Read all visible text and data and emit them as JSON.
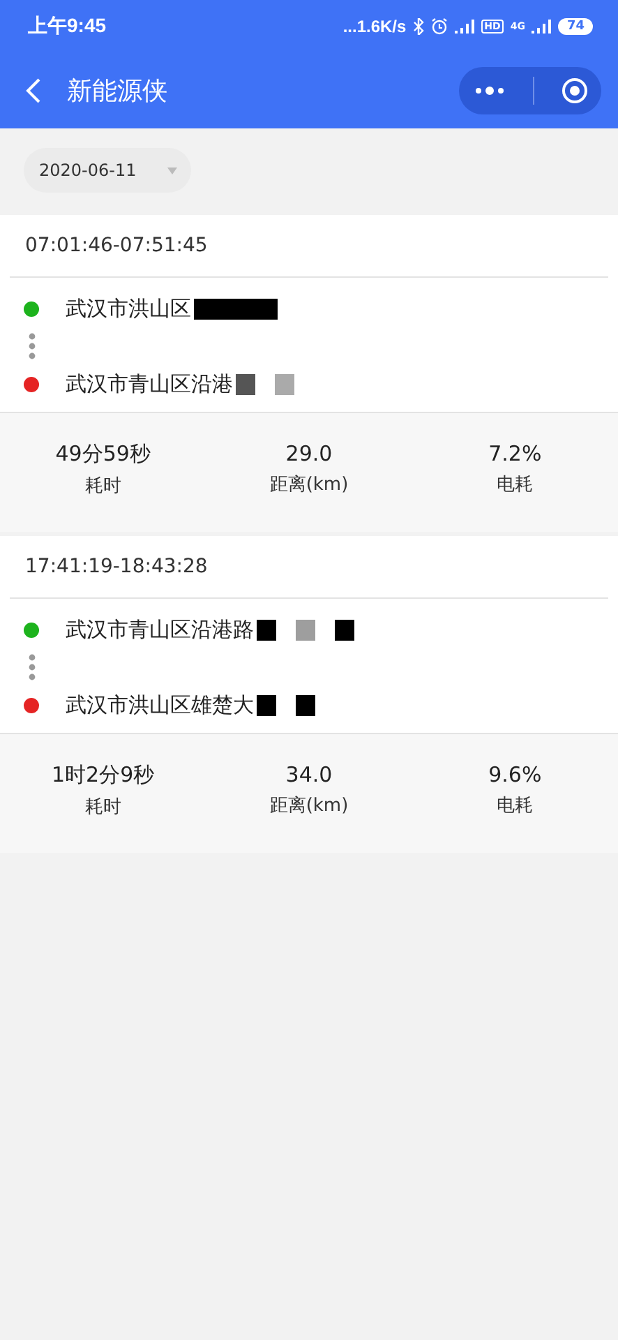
{
  "status_bar": {
    "time": "上午9:45",
    "speed": "...1.6K/s",
    "network": "4G",
    "hd": "HD",
    "battery": "74"
  },
  "header": {
    "title": "新能源侠"
  },
  "date_picker": {
    "value": "2020-06-11"
  },
  "trips": [
    {
      "time_range": "07:01:46-07:51:45",
      "stops": [
        {
          "kind": "start",
          "address": "武汉市洪山区",
          "redactions": [
            {
              "color": "#000000",
              "wide": true
            }
          ]
        },
        {
          "kind": "end",
          "address": "武汉市青山区沿港",
          "redactions": [
            {
              "color": "#555555",
              "wide": false
            },
            {
              "color": "#aaaaaa",
              "wide": false
            }
          ]
        }
      ],
      "stats": [
        {
          "value": "49分59秒",
          "label": "耗时"
        },
        {
          "value": "29.0",
          "label": "距离(km)"
        },
        {
          "value": "7.2%",
          "label": "电耗"
        }
      ]
    },
    {
      "time_range": "17:41:19-18:43:28",
      "stops": [
        {
          "kind": "start",
          "address": "武汉市青山区沿港路",
          "redactions": [
            {
              "color": "#000000",
              "wide": false
            },
            {
              "color": "#9e9e9e",
              "wide": false
            },
            {
              "color": "#000000",
              "wide": false
            }
          ]
        },
        {
          "kind": "end",
          "address": "武汉市洪山区雄楚大",
          "redactions": [
            {
              "color": "#000000",
              "wide": false
            },
            {
              "color": "#000000",
              "wide": false
            }
          ]
        }
      ],
      "stats": [
        {
          "value": "1时2分9秒",
          "label": "耗时"
        },
        {
          "value": "34.0",
          "label": "距离(km)"
        },
        {
          "value": "9.6%",
          "label": "电耗"
        }
      ]
    }
  ]
}
